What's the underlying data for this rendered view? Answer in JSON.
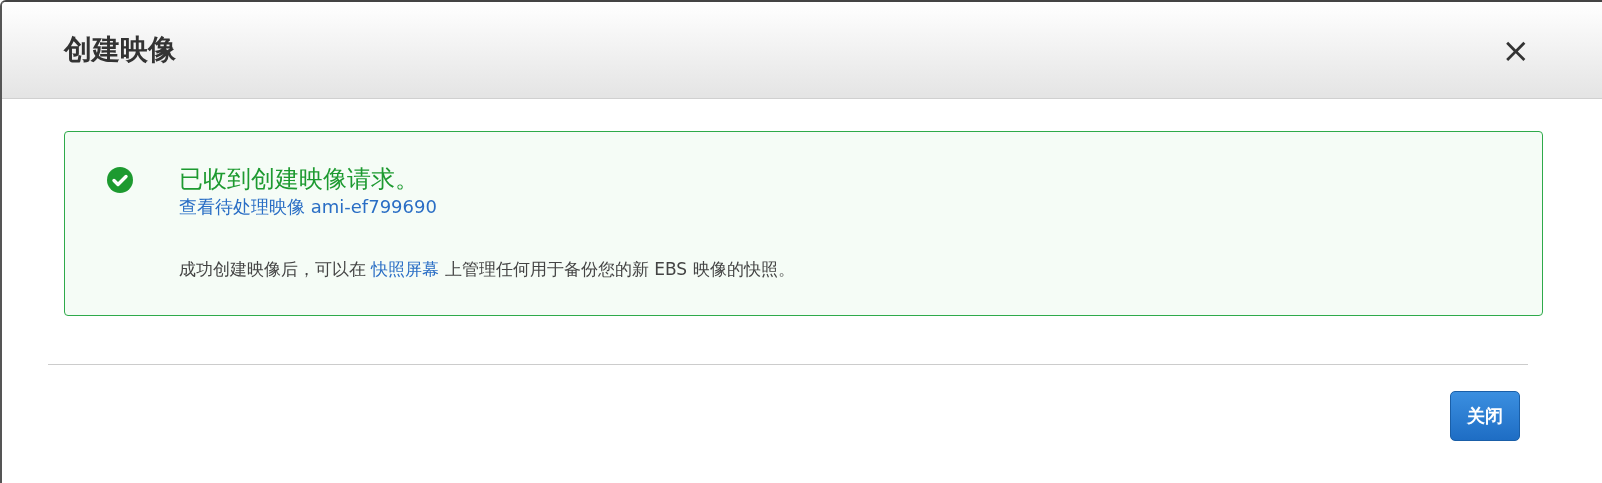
{
  "dialog": {
    "title": "创建映像",
    "close_icon": "×"
  },
  "alert": {
    "kind": "success",
    "heading": "已收到创建映像请求。",
    "link": "查看待处理映像 ami-ef799690",
    "message": {
      "before": "成功创建映像后，可以在 ",
      "link": "快照屏幕",
      "after": " 上管理任何用于备份您的新 EBS 映像的快照。"
    }
  },
  "buttons": [
    {
      "label": "关闭",
      "kind": "primary"
    }
  ]
}
